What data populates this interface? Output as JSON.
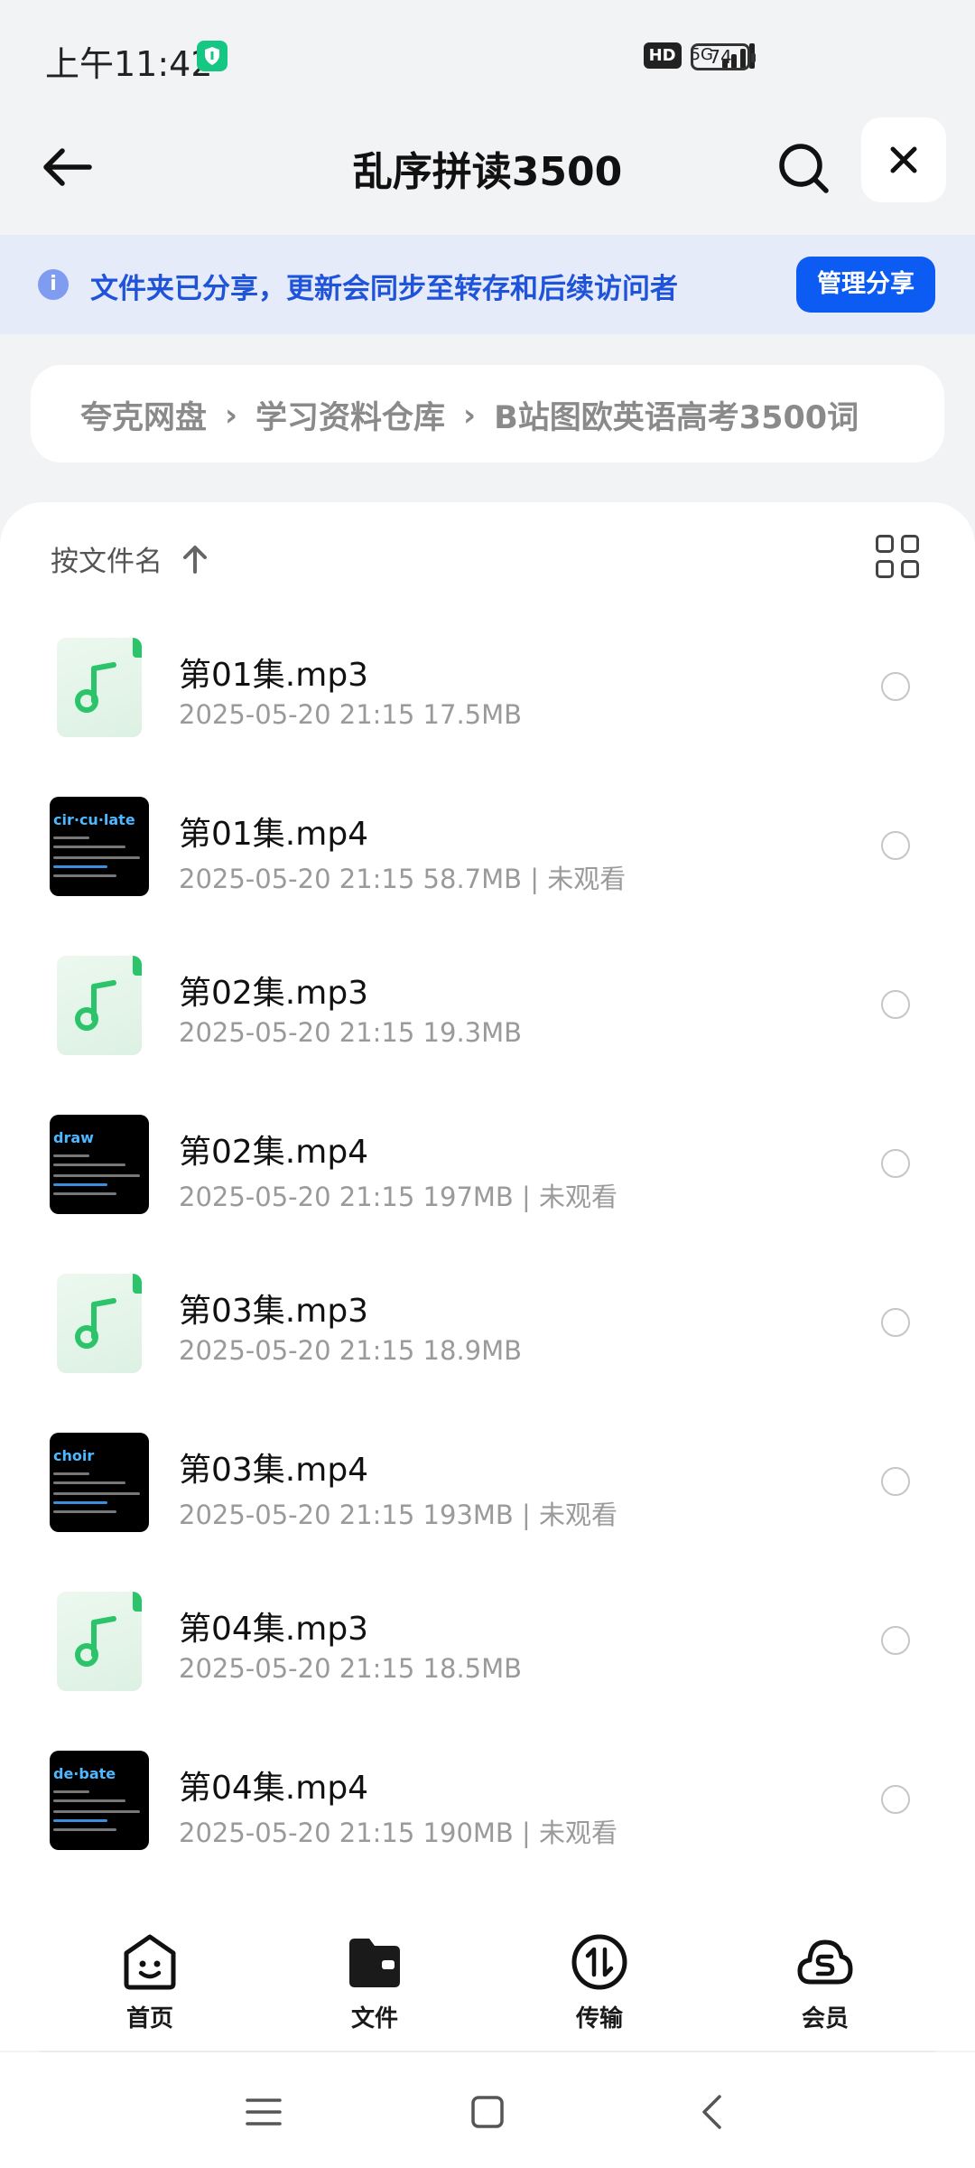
{
  "status_bar": {
    "time": "上午11:42",
    "hd": "HD",
    "network": "5G",
    "battery": "74"
  },
  "header": {
    "title": "乱序拼读3500",
    "icons": [
      "back-arrow-icon",
      "search-icon",
      "close-icon"
    ]
  },
  "banner": {
    "text": "文件夹已分享，更新会同步至转存和后续访问者",
    "button": "管理分享",
    "accent": "#0c5bf2"
  },
  "breadcrumb": {
    "items": [
      "夸克网盘",
      "学习资料仓库",
      "B站图欧英语高考3500词"
    ]
  },
  "sort": {
    "label": "按文件名",
    "direction_icon": "arrow-up-icon",
    "view_icon": "grid-view-icon"
  },
  "files": [
    {
      "name": "第01集.mp3",
      "meta": "2025-05-20 21:15  17.5MB",
      "type": "audio"
    },
    {
      "name": "第01集.mp4",
      "meta": "2025-05-20 21:15  58.7MB | 未观看",
      "type": "video",
      "thumb_word": "cir·cu·late"
    },
    {
      "name": "第02集.mp3",
      "meta": "2025-05-20 21:15  19.3MB",
      "type": "audio"
    },
    {
      "name": "第02集.mp4",
      "meta": "2025-05-20 21:15  197MB | 未观看",
      "type": "video",
      "thumb_word": "draw"
    },
    {
      "name": "第03集.mp3",
      "meta": "2025-05-20 21:15  18.9MB",
      "type": "audio"
    },
    {
      "name": "第03集.mp4",
      "meta": "2025-05-20 21:15  193MB | 未观看",
      "type": "video",
      "thumb_word": "choir"
    },
    {
      "name": "第04集.mp3",
      "meta": "2025-05-20 21:15  18.5MB",
      "type": "audio"
    },
    {
      "name": "第04集.mp4",
      "meta": "2025-05-20 21:15  190MB | 未观看",
      "type": "video",
      "thumb_word": "de·bate"
    }
  ],
  "bottom_nav": {
    "items": [
      {
        "label": "首页",
        "icon": "home-smile-icon"
      },
      {
        "label": "文件",
        "icon": "folder-icon"
      },
      {
        "label": "传输",
        "icon": "transfer-icon"
      },
      {
        "label": "会员",
        "icon": "vip-cloud-icon"
      }
    ]
  },
  "system_nav": {
    "icons": [
      "menu-icon",
      "home-square-icon",
      "back-chevron-icon"
    ]
  }
}
